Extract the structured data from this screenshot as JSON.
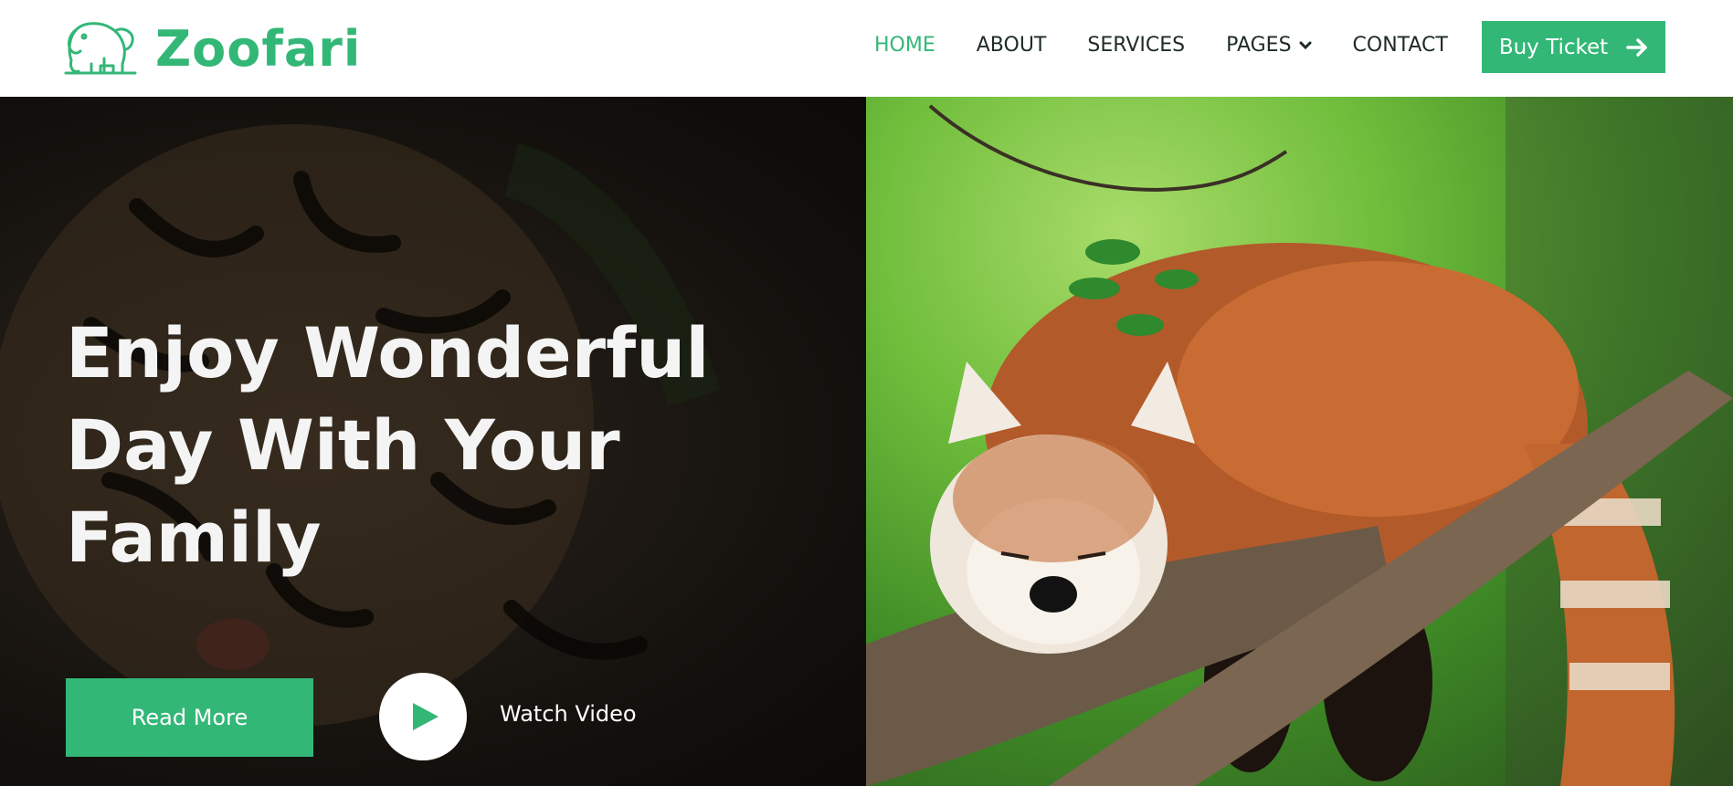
{
  "brand": {
    "name": "Zoofari",
    "logo_icon": "elephant-icon"
  },
  "nav": {
    "items": [
      {
        "label": "HOME",
        "active": true
      },
      {
        "label": "ABOUT",
        "active": false
      },
      {
        "label": "SERVICES",
        "active": false
      },
      {
        "label": "PAGES",
        "active": false,
        "dropdown": true
      },
      {
        "label": "CONTACT",
        "active": false
      }
    ],
    "cta": {
      "label": "Buy Ticket",
      "icon": "arrow-right-icon"
    }
  },
  "hero": {
    "title": "Enjoy Wonderful Day With Your Family",
    "primary_button": "Read More",
    "video_link": "Watch Video",
    "left_image": "tiger-image",
    "right_image": "red-panda-image"
  },
  "colors": {
    "accent": "#33b777",
    "nav_text": "#1e2b24",
    "hero_text": "#f4f4f4"
  }
}
